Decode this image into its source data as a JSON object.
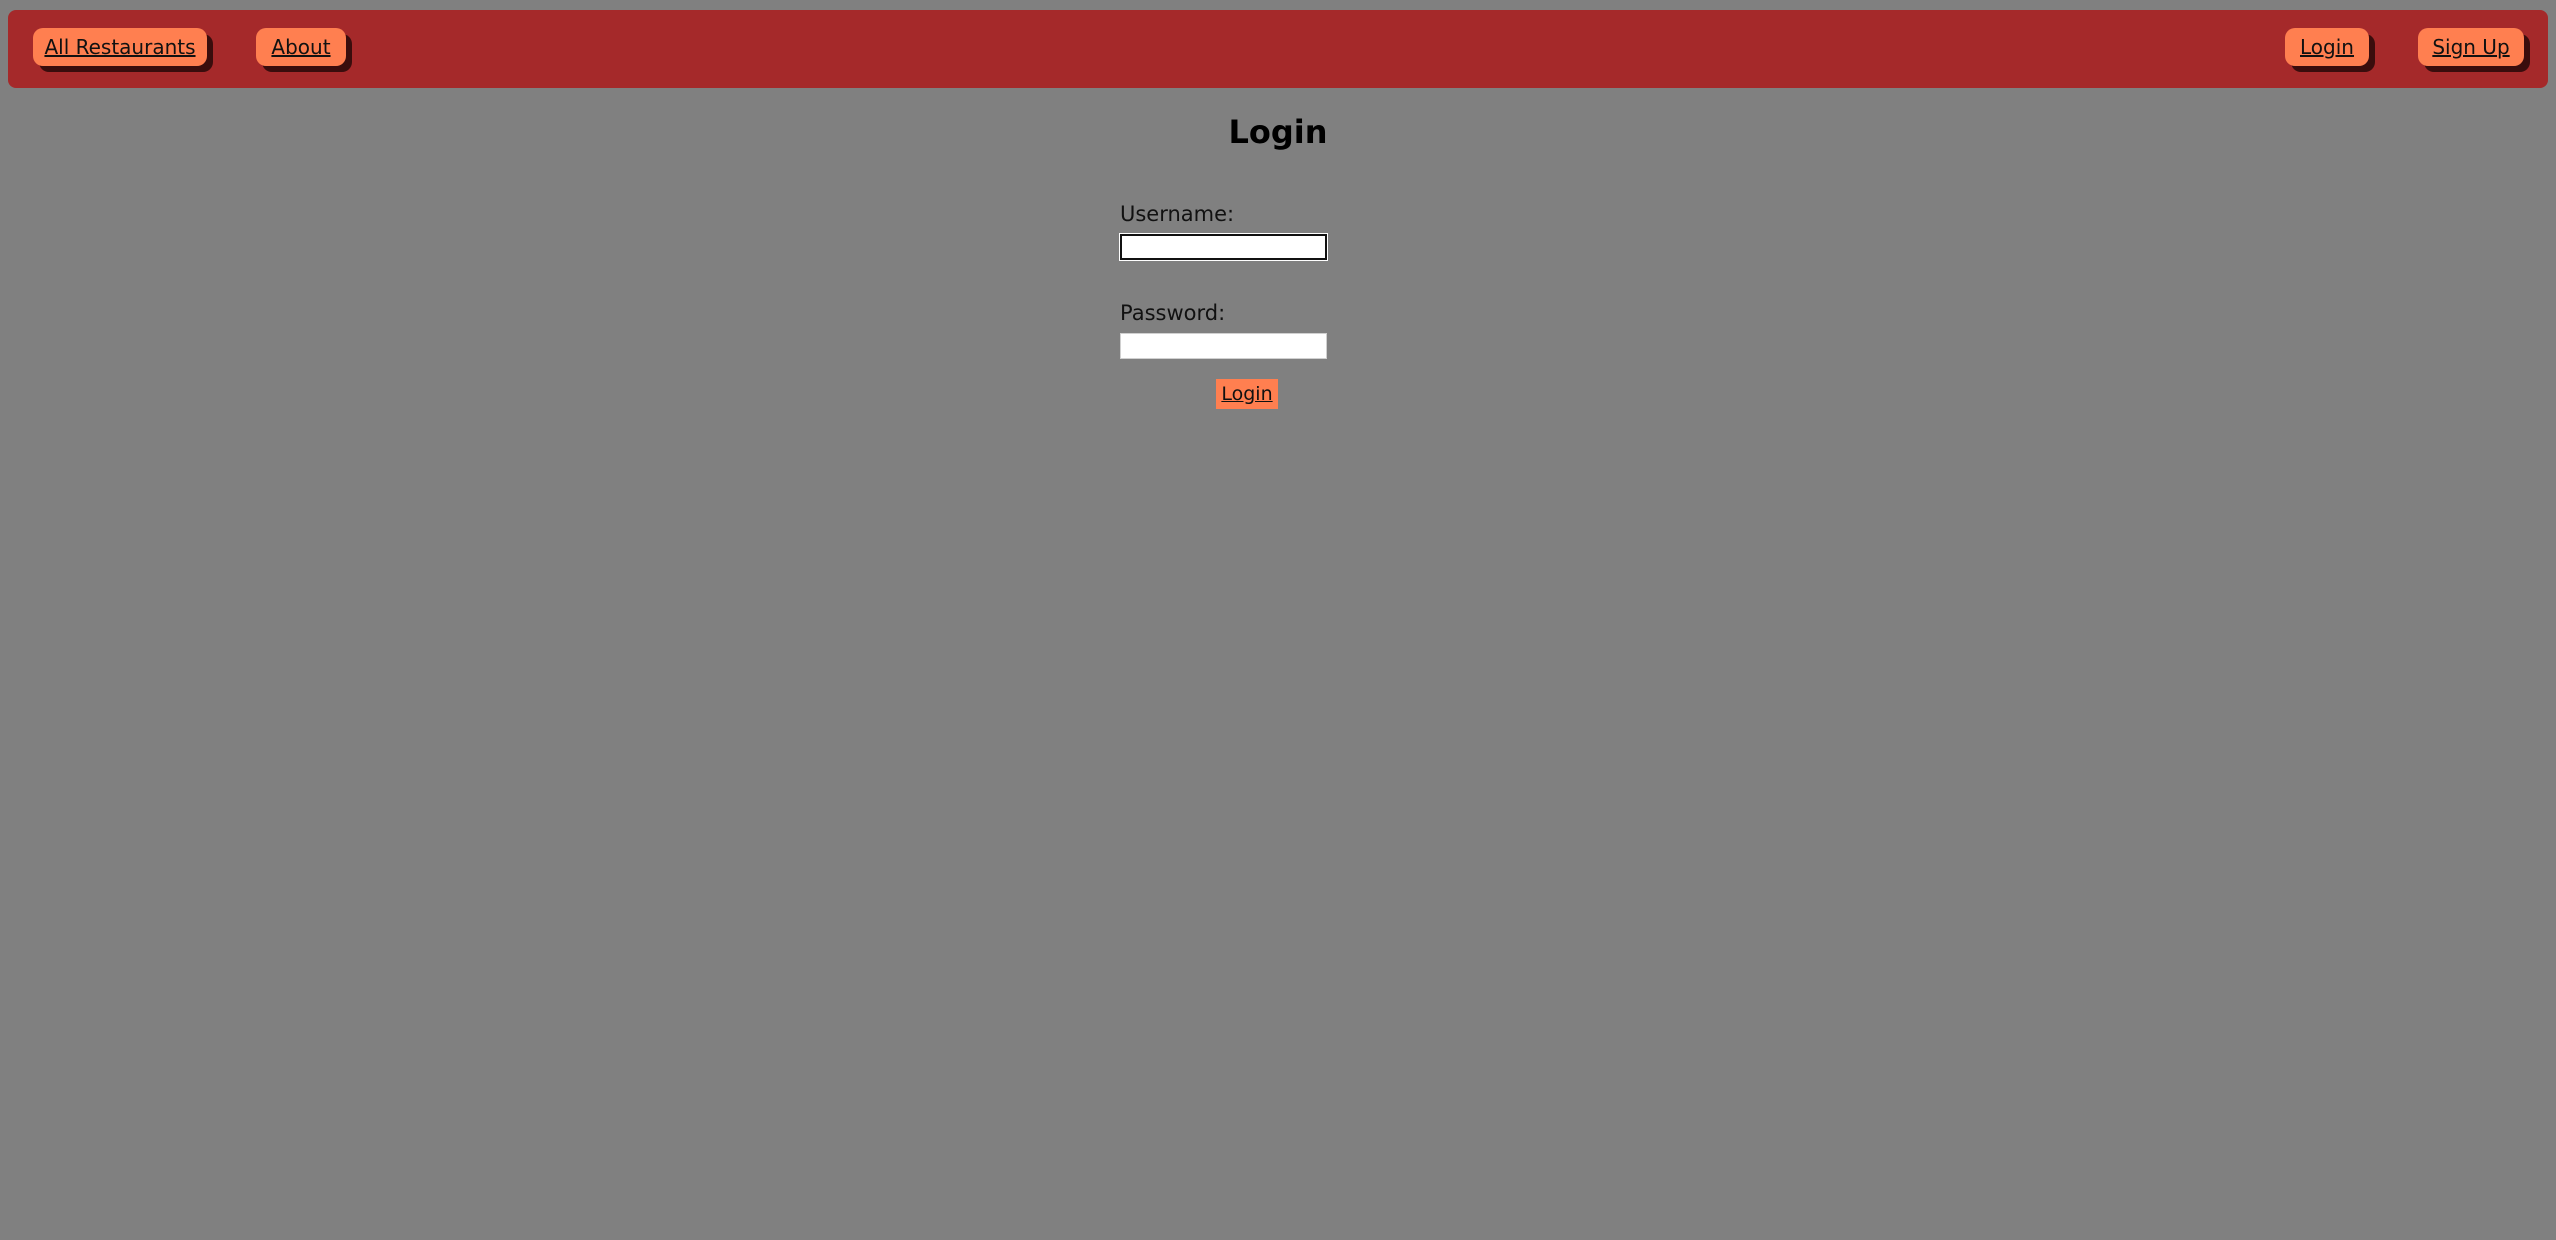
{
  "nav": {
    "all_restaurants": "All Restaurants",
    "about": "About",
    "login": "Login",
    "sign_up": "Sign Up"
  },
  "page": {
    "title": "Login"
  },
  "form": {
    "username_label": "Username:",
    "username_value": "",
    "password_label": "Password:",
    "password_value": "",
    "submit_label": "Login"
  },
  "colors": {
    "navbar": "#a5292a",
    "button": "#ff7f50",
    "background": "#808080"
  }
}
